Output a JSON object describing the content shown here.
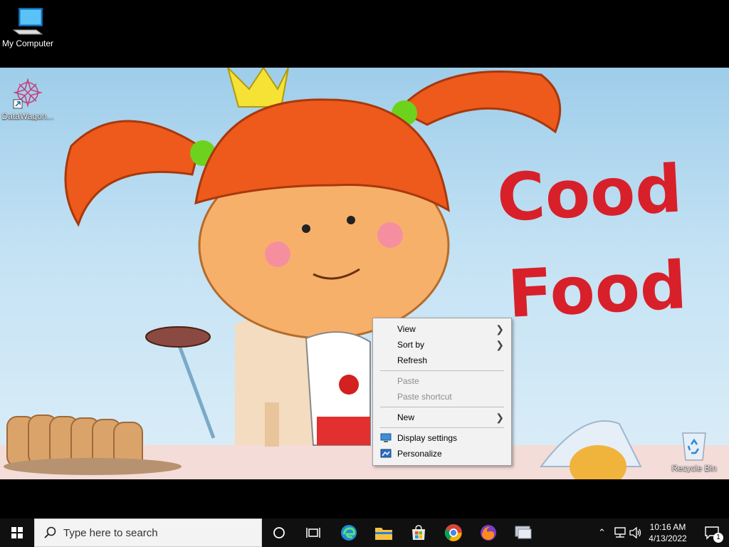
{
  "desktop": {
    "icons": [
      {
        "label": "My Computer"
      },
      {
        "label": "DataWagon..."
      },
      {
        "label": "Recycle Bin"
      }
    ],
    "wallpaper_text": [
      "Cood",
      "Food"
    ]
  },
  "context_menu": {
    "items": {
      "view": "View",
      "sort_by": "Sort by",
      "refresh": "Refresh",
      "paste": "Paste",
      "paste_shortcut": "Paste shortcut",
      "new": "New",
      "display_settings": "Display settings",
      "personalize": "Personalize"
    }
  },
  "taskbar": {
    "search_placeholder": "Type here to search",
    "pinned": [
      "cortana-icon",
      "task-view-icon",
      "edge-icon",
      "file-explorer-icon",
      "store-icon",
      "chrome-icon",
      "firefox-icon",
      "app-icon"
    ],
    "clock": {
      "time": "10:16 AM",
      "date": "4/13/2022"
    },
    "notification_count": "1"
  },
  "colors": {
    "taskbar": "#101010",
    "menu_bg": "#f2f2f2",
    "wallpaper_text": "#d8202a"
  }
}
